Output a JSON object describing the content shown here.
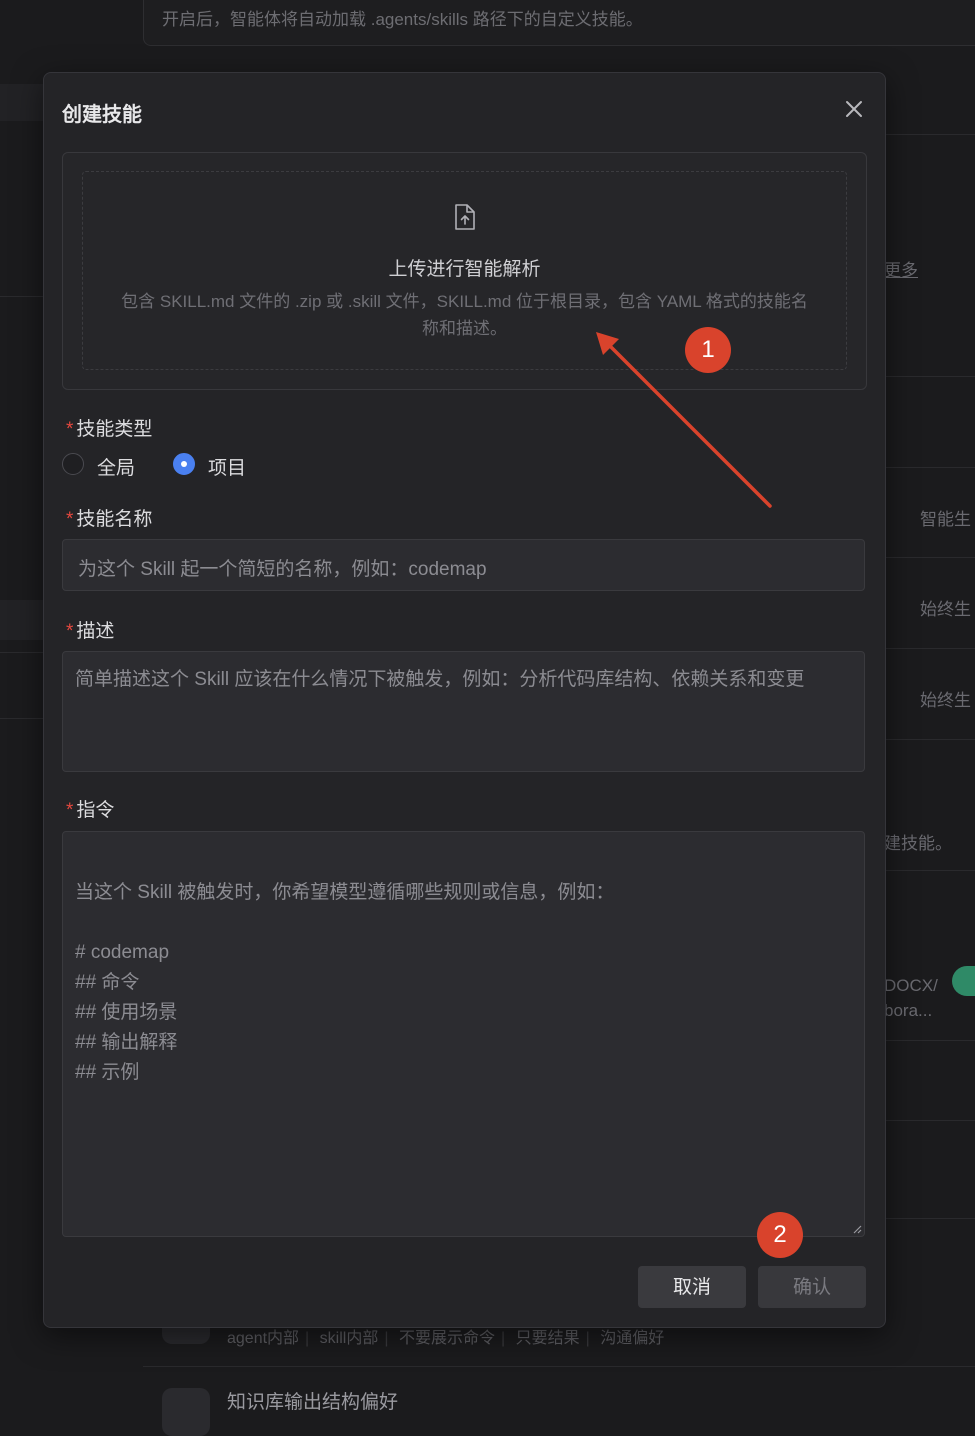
{
  "background": {
    "top_hint": "开启后，智能体将自动加载 .agents/skills 路径下的自定义技能。",
    "right_texts": [
      "更多",
      "智能生",
      "始终生",
      "始终生",
      "建技能。",
      "DOCX/",
      "bora..."
    ],
    "tags": [
      "agent内部",
      "skill内部",
      "不要展示命令",
      "只要结果",
      "沟通偏好"
    ],
    "item_title": "知识库输出结构偏好",
    "toggle_color": "#2f8a67"
  },
  "modal": {
    "title": "创建技能",
    "upload": {
      "title": "上传进行智能解析",
      "description": "包含 SKILL.md 文件的 .zip 或 .skill 文件，SKILL.md 位于根目录，包含 YAML 格式的技能名称和描述。"
    },
    "skill_type": {
      "label": "技能类型",
      "options": [
        "全局",
        "项目"
      ],
      "selected": "项目"
    },
    "skill_name": {
      "label": "技能名称",
      "placeholder": "为这个 Skill 起一个简短的名称，例如：codemap"
    },
    "description": {
      "label": "描述",
      "placeholder": "简单描述这个 Skill 应该在什么情况下被触发，例如：分析代码库结构、依赖关系和变更"
    },
    "instructions": {
      "label": "指令",
      "placeholder": "当这个 Skill 被触发时，你希望模型遵循哪些规则或信息，例如：\n\n# codemap\n## 命令\n## 使用场景\n## 输出解释\n## 示例"
    },
    "buttons": {
      "cancel": "取消",
      "confirm": "确认"
    }
  },
  "annotations": {
    "badge_1": "1",
    "badge_2": "2",
    "badge_color": "#d9432c"
  },
  "colors": {
    "accent": "#4a80f0",
    "required": "#e5483f",
    "modal_bg": "#242427"
  }
}
